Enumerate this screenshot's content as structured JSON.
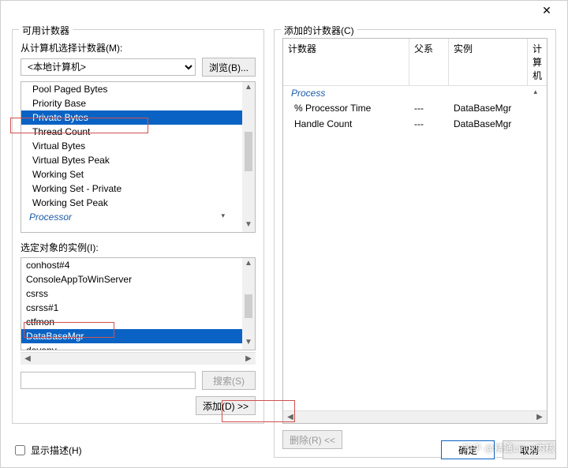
{
  "window": {
    "close_label": "✕"
  },
  "left": {
    "group_title": "可用计数器",
    "computer_label": "从计算机选择计数器(M):",
    "computer_value": "<本地计算机>",
    "browse_label": "浏览(B)...",
    "counters": [
      {
        "text": "Pool Paged Bytes",
        "selected": false,
        "type": "item"
      },
      {
        "text": "Priority Base",
        "selected": false,
        "type": "item"
      },
      {
        "text": "Private Bytes",
        "selected": true,
        "type": "item"
      },
      {
        "text": "Thread Count",
        "selected": false,
        "type": "item"
      },
      {
        "text": "Virtual Bytes",
        "selected": false,
        "type": "item"
      },
      {
        "text": "Virtual Bytes Peak",
        "selected": false,
        "type": "item"
      },
      {
        "text": "Working Set",
        "selected": false,
        "type": "item"
      },
      {
        "text": "Working Set - Private",
        "selected": false,
        "type": "item"
      },
      {
        "text": "Working Set Peak",
        "selected": false,
        "type": "item"
      },
      {
        "text": "Processor",
        "selected": false,
        "type": "category"
      }
    ],
    "instances_label": "选定对象的实例(I):",
    "instances": [
      {
        "text": "conhost#4",
        "selected": false
      },
      {
        "text": "ConsoleAppToWinServer",
        "selected": false
      },
      {
        "text": "csrss",
        "selected": false
      },
      {
        "text": "csrss#1",
        "selected": false
      },
      {
        "text": "ctfmon",
        "selected": false
      },
      {
        "text": "DataBaseMgr",
        "selected": true
      },
      {
        "text": "devenv",
        "selected": false
      }
    ],
    "search_label": "搜索(S)",
    "add_label": "添加(D) >>"
  },
  "right": {
    "group_title": "添加的计数器(C)",
    "headers": {
      "counter": "计数器",
      "parent": "父系",
      "instance": "实例",
      "computer": "计算机"
    },
    "category": "Process",
    "rows": [
      {
        "counter": "% Processor Time",
        "parent": "---",
        "instance": "DataBaseMgr",
        "computer": ""
      },
      {
        "counter": "Handle Count",
        "parent": "---",
        "instance": "DataBaseMgr",
        "computer": ""
      }
    ],
    "remove_label": "删除(R) <<"
  },
  "bottom": {
    "show_desc_label": "显示描述(H)",
    "ok_label": "确定",
    "cancel_label": "取消"
  },
  "watermark": "知乎 @精通Linux内核"
}
